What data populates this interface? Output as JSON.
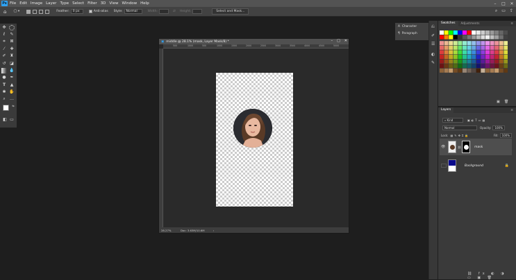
{
  "app": {
    "menu": [
      "File",
      "Edit",
      "Image",
      "Layer",
      "Type",
      "Select",
      "Filter",
      "3D",
      "View",
      "Window",
      "Help"
    ],
    "logo": "Ps"
  },
  "options": {
    "feather_label": "Feather:",
    "feather_value": "0 px",
    "antialias_label": "Anti-alias",
    "style_label": "Style:",
    "style_value": "Normal",
    "width_label": "Width:",
    "height_label": "Height:",
    "select_mask": "Select and Mask..."
  },
  "document": {
    "title": "middle @ 28.1% (mask, Layer Mask/8) *",
    "zoom": "28.27%",
    "doc_info": "Doc: 3.63M/10.6M",
    "ruler_marks": [
      "500",
      "1000",
      "500",
      "1000",
      "1500",
      "2000",
      "2500",
      "3000",
      "3500",
      "4000",
      "4500",
      "5000"
    ]
  },
  "char_panel": {
    "items": [
      "Character",
      "Paragraph"
    ]
  },
  "swatches_panel": {
    "tabs": [
      "Swatches",
      "Adjustments"
    ]
  },
  "layers_panel": {
    "tab": "Layers",
    "kind": "Kind",
    "blend_mode": "Normal",
    "opacity_label": "Opacity:",
    "opacity_value": "100%",
    "lock_label": "Lock:",
    "fill_label": "Fill:",
    "fill_value": "100%",
    "layers": [
      {
        "name": "mask",
        "visible": true
      },
      {
        "name": "Background",
        "visible": false,
        "locked": true
      }
    ]
  },
  "colors": {
    "accent": "#2fa3f3",
    "background_swatch": "#0a0a8c"
  }
}
